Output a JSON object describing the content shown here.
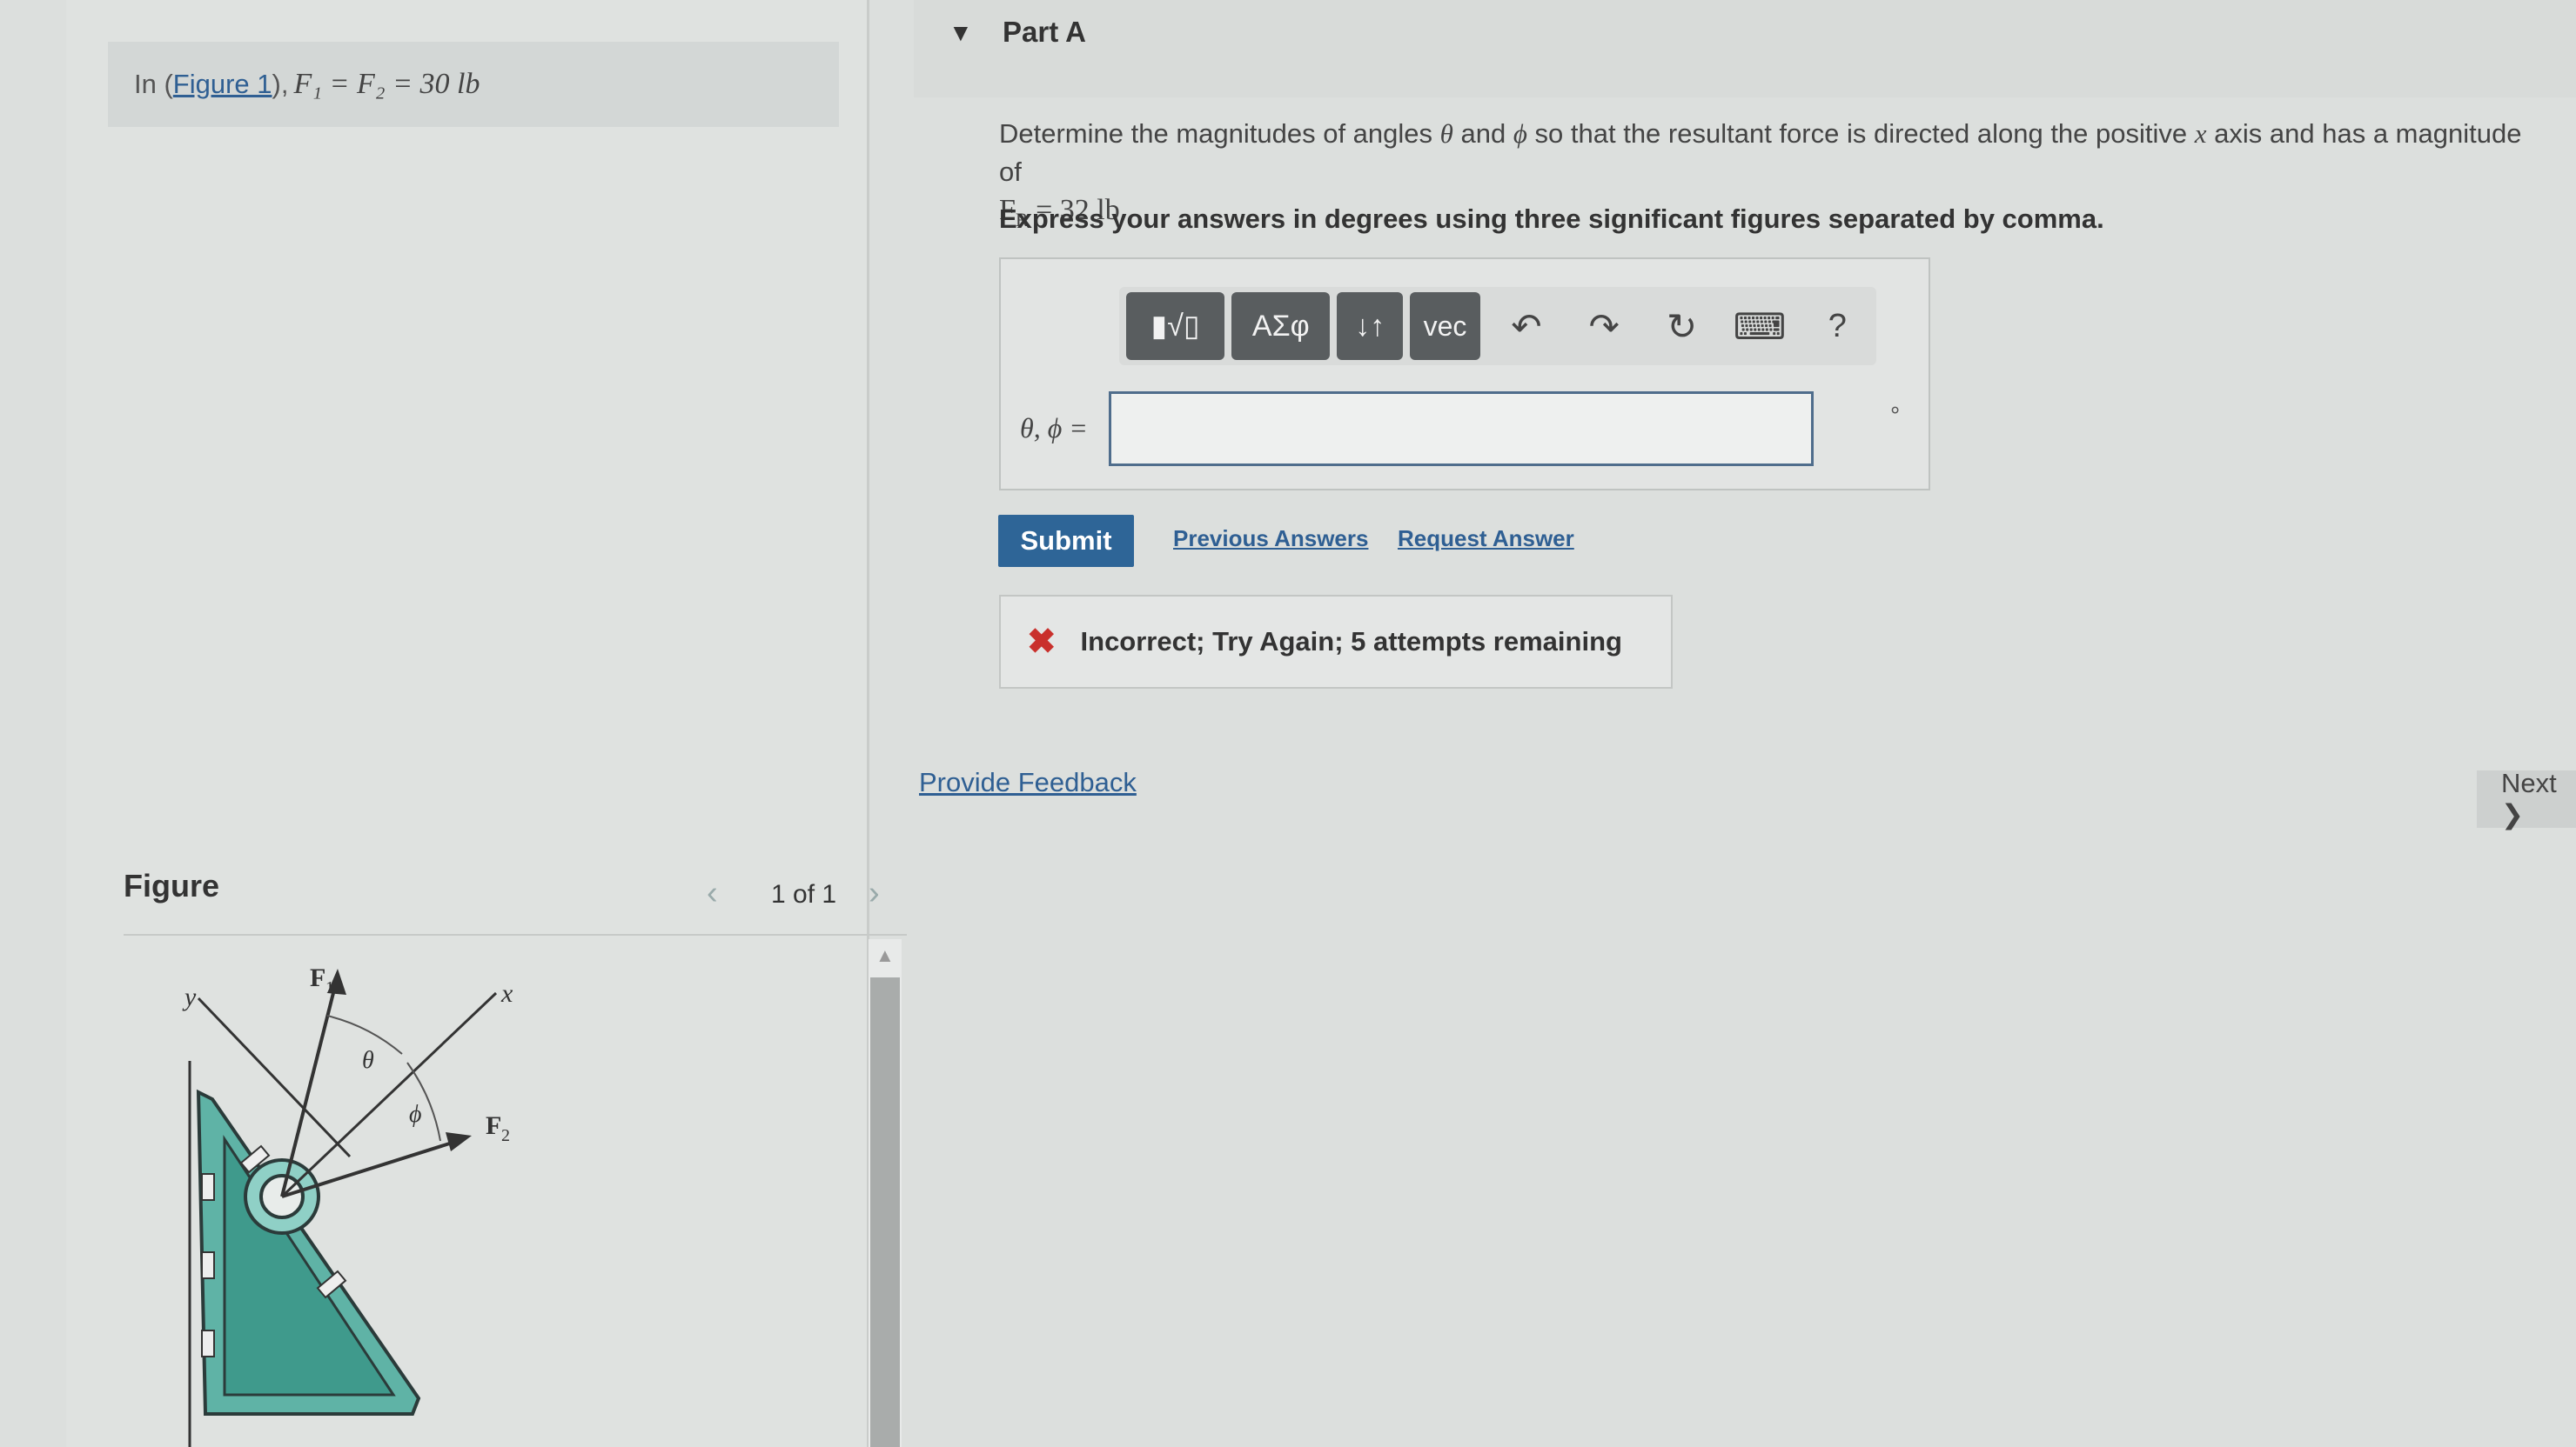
{
  "problem": {
    "prefix": "In (",
    "figure_link": "Figure 1",
    "suffix": "),",
    "equation": "F₁ = F₂ = 30 lb"
  },
  "figure": {
    "title": "Figure",
    "counter": "1 of 1",
    "prev_icon": "chevron-left-icon",
    "next_icon": "chevron-right-icon",
    "labels": {
      "y_axis": "y",
      "x_axis": "x",
      "f1": "F",
      "f1_sub": "1",
      "f2": "F",
      "f2_sub": "2",
      "theta": "θ",
      "phi": "ϕ"
    }
  },
  "part": {
    "title": "Part A",
    "collapse_icon": "triangle-down-icon"
  },
  "question": {
    "text_before_theta": "Determine the magnitudes of angles",
    "theta": "θ",
    "and": "and",
    "phi": "ϕ",
    "text_after_phi": "so that the resultant force is directed along the positive",
    "x": "x",
    "text_end": "axis and has a magnitude of",
    "fr_value": "F",
    "fr_sub": "R",
    "fr_eq": " = 32 lb",
    "instruction": "Express your answers in degrees using three significant figures separated by comma."
  },
  "toolbar": {
    "template_label": "▮√▯",
    "greek_label": "ΑΣφ",
    "updown_label": "↓↑",
    "vec_label": "vec",
    "undo_icon": "↶",
    "redo_icon": "↷",
    "reset_icon": "↻",
    "keyboard_icon": "⌨",
    "help_icon": "?"
  },
  "answer": {
    "label": "θ, ϕ =",
    "value": "",
    "unit": "°"
  },
  "actions": {
    "submit": "Submit",
    "previous_answers": "Previous Answers",
    "request_answer": "Request Answer"
  },
  "feedback": {
    "icon": "✖",
    "text": "Incorrect; Try Again; 5 attempts remaining"
  },
  "footer": {
    "provide_feedback": "Provide Feedback",
    "next": "Next ❯"
  }
}
